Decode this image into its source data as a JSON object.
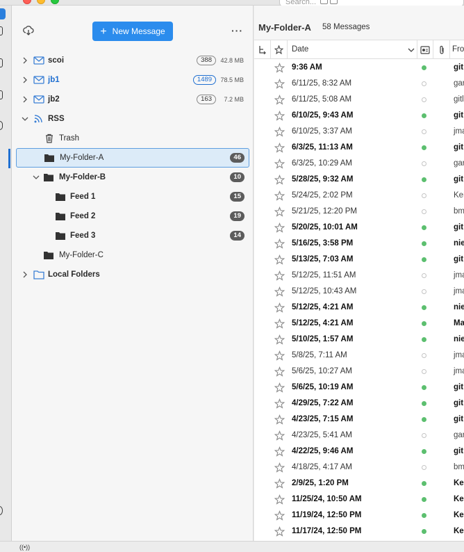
{
  "search": {
    "placeholder": "Search..."
  },
  "folder_pane": {
    "new_message_label": "New Message",
    "accounts": [
      {
        "name": "scoi",
        "count": "388",
        "size": "42.8 MB"
      },
      {
        "name": "jb1",
        "count": "1489",
        "size": "78.5 MB"
      },
      {
        "name": "jb2",
        "count": "163",
        "size": "7.2 MB"
      },
      {
        "name": "RSS"
      }
    ],
    "folders": {
      "trash": "Trash",
      "folder_a": {
        "name": "My-Folder-A",
        "count": "46"
      },
      "folder_b": {
        "name": "My-Folder-B",
        "count": "10"
      },
      "feed1": {
        "name": "Feed 1",
        "count": "15"
      },
      "feed2": {
        "name": "Feed 2",
        "count": "19"
      },
      "feed3": {
        "name": "Feed 3",
        "count": "14"
      },
      "folder_c": {
        "name": "My-Folder-C"
      },
      "local": {
        "name": "Local Folders"
      }
    }
  },
  "thread_pane": {
    "folder_title": "My-Folder-A",
    "message_count": "58 Messages",
    "columns": {
      "date": "Date",
      "from": "Fro"
    },
    "messages": [
      {
        "date": "9:36 AM",
        "from": "git",
        "unread": true
      },
      {
        "date": "6/11/25, 8:32 AM",
        "from": "gar",
        "unread": false
      },
      {
        "date": "6/11/25, 5:08 AM",
        "from": "gitl",
        "unread": false
      },
      {
        "date": "6/10/25, 9:43 AM",
        "from": "git",
        "unread": true
      },
      {
        "date": "6/10/25, 3:37 AM",
        "from": "jma",
        "unread": false
      },
      {
        "date": "6/3/25, 11:13 AM",
        "from": "git",
        "unread": true
      },
      {
        "date": "6/3/25, 10:29 AM",
        "from": "gar",
        "unread": false
      },
      {
        "date": "5/28/25, 9:32 AM",
        "from": "git",
        "unread": true
      },
      {
        "date": "5/24/25, 2:02 PM",
        "from": "Ker",
        "unread": false
      },
      {
        "date": "5/21/25, 12:20 PM",
        "from": "bm",
        "unread": false
      },
      {
        "date": "5/20/25, 10:01 AM",
        "from": "git",
        "unread": true
      },
      {
        "date": "5/16/25, 3:58 PM",
        "from": "nie",
        "unread": true
      },
      {
        "date": "5/13/25, 7:03 AM",
        "from": "git",
        "unread": true
      },
      {
        "date": "5/12/25, 11:51 AM",
        "from": "jma",
        "unread": false
      },
      {
        "date": "5/12/25, 10:43 AM",
        "from": "jma",
        "unread": false
      },
      {
        "date": "5/12/25, 4:21 AM",
        "from": "nie",
        "unread": true
      },
      {
        "date": "5/12/25, 4:21 AM",
        "from": "Ma",
        "unread": true
      },
      {
        "date": "5/10/25, 1:57 AM",
        "from": "nie",
        "unread": true
      },
      {
        "date": "5/8/25, 7:11 AM",
        "from": "jma",
        "unread": false
      },
      {
        "date": "5/6/25, 10:27 AM",
        "from": "jma",
        "unread": false
      },
      {
        "date": "5/6/25, 10:19 AM",
        "from": "git",
        "unread": true
      },
      {
        "date": "4/29/25, 7:22 AM",
        "from": "git",
        "unread": true
      },
      {
        "date": "4/23/25, 7:15 AM",
        "from": "git",
        "unread": true
      },
      {
        "date": "4/23/25, 5:41 AM",
        "from": "gar",
        "unread": false
      },
      {
        "date": "4/22/25, 9:46 AM",
        "from": "git",
        "unread": true
      },
      {
        "date": "4/18/25, 4:17 AM",
        "from": "bm",
        "unread": false
      },
      {
        "date": "2/9/25, 1:20 PM",
        "from": "Ker",
        "unread": true
      },
      {
        "date": "11/25/24, 10:50 AM",
        "from": "Ker",
        "unread": true
      },
      {
        "date": "11/19/24, 12:50 PM",
        "from": "Ker",
        "unread": true
      },
      {
        "date": "11/17/24, 12:50 PM",
        "from": "Ker",
        "unread": true
      }
    ]
  },
  "colors": {
    "accent": "#2b8ced",
    "selection_bg": "#dcebf8",
    "unread_dot": "#5cbf6f"
  }
}
